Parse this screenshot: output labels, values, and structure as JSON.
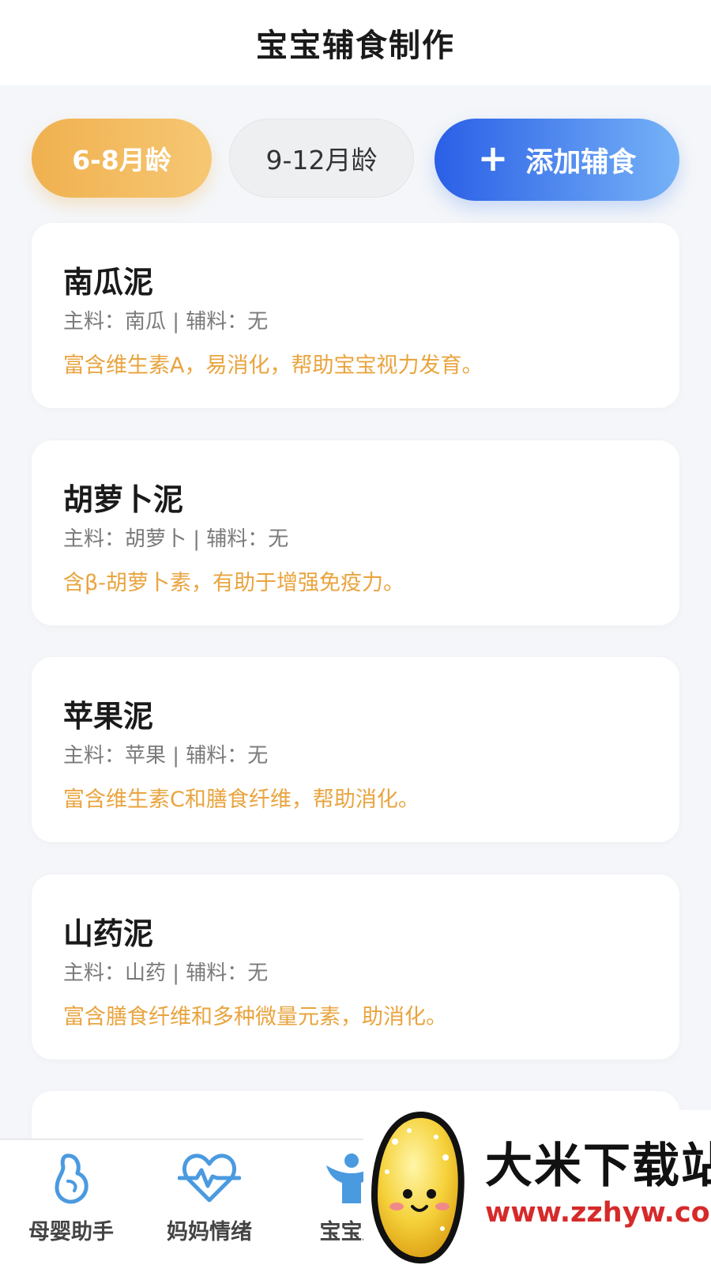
{
  "header": {
    "title": "宝宝辅食制作"
  },
  "filters": {
    "age_active": "6-8月龄",
    "age_inactive": "9-12月龄",
    "add_button_icon": "plus-icon",
    "add_button_label": "添加辅食"
  },
  "recipes": [
    {
      "name": "南瓜泥",
      "ingredients": "主料：南瓜 | 辅料：无",
      "description": "富含维生素A，易消化，帮助宝宝视力发育。"
    },
    {
      "name": "胡萝卜泥",
      "ingredients": "主料：胡萝卜 | 辅料：无",
      "description": "含β-胡萝卜素，有助于增强免疫力。"
    },
    {
      "name": "苹果泥",
      "ingredients": "主料：苹果 | 辅料：无",
      "description": "富含维生素C和膳食纤维，帮助消化。"
    },
    {
      "name": "山药泥",
      "ingredients": "主料：山药 | 辅料：无",
      "description": "富含膳食纤维和多种微量元素，助消化。"
    }
  ],
  "tabbar": {
    "items": [
      {
        "label": "母婴助手",
        "icon": "pregnant-mother-icon"
      },
      {
        "label": "妈妈情绪",
        "icon": "heart-pulse-icon"
      },
      {
        "label": "宝宝成",
        "icon": "baby-icon"
      }
    ]
  },
  "watermark": {
    "title": "大米下载站",
    "url": "www.zzhyw.com",
    "icon": "rice-mascot-icon"
  },
  "colors": {
    "accent_orange": "#f0b14f",
    "accent_blue": "#2a5fe6",
    "description_text": "#e9a43f",
    "tab_icon_blue": "#4a9ae0"
  }
}
